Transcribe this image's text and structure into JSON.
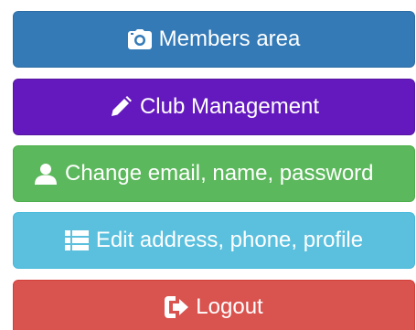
{
  "menu": {
    "items": [
      {
        "label": "Members area",
        "icon": "camera-icon",
        "color": "#337ab7"
      },
      {
        "label": "Club Management",
        "icon": "pencil-icon",
        "color": "#6419be"
      },
      {
        "label": "Change email, name, password",
        "icon": "user-icon",
        "color": "#5cb85c"
      },
      {
        "label": "Edit address, phone, profile",
        "icon": "list-icon",
        "color": "#5bc0de"
      },
      {
        "label": "Logout",
        "icon": "logout-icon",
        "color": "#d9534f"
      }
    ]
  }
}
